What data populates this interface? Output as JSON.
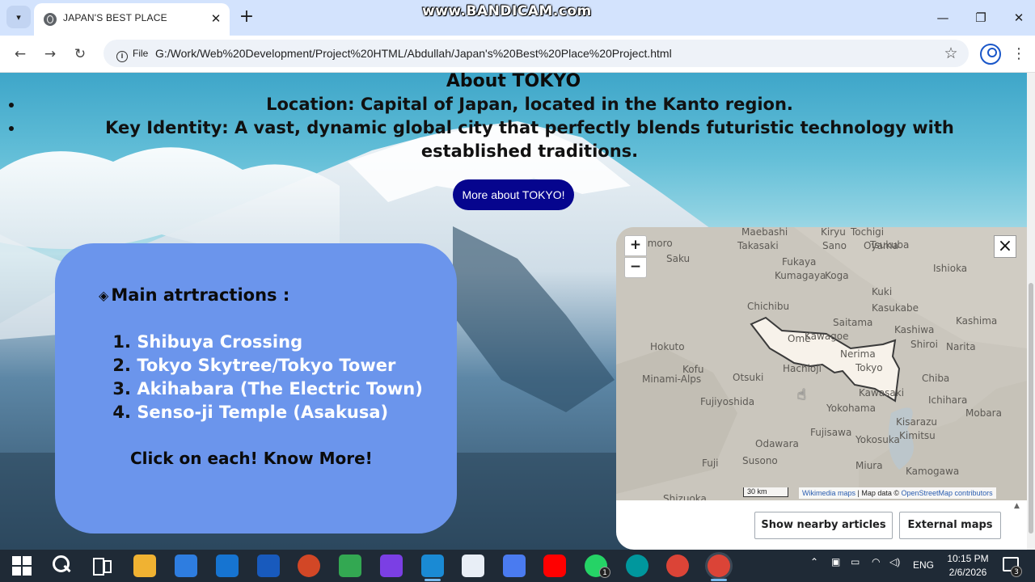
{
  "browser": {
    "tab_title": "JAPAN'S BEST PLACE",
    "file_chip": "File",
    "url": "G:/Work/Web%20Development/Project%20HTML/Abdullah/Japan's%20Best%20Place%20Project.html",
    "watermark": "www.BANDICAM.com",
    "icons": [
      "tab-search-icon",
      "globe-icon",
      "close-icon",
      "plus-icon",
      "back-icon",
      "forward-icon",
      "reload-icon",
      "info-icon",
      "star-icon",
      "profile-icon",
      "menu-icon",
      "minimize-icon",
      "restore-icon",
      "window-close-icon"
    ]
  },
  "page": {
    "heading": "About TOKYO",
    "bullets": [
      {
        "label": "Location:",
        "text": "Capital of Japan, located in the Kanto region."
      },
      {
        "label": "Key Identity:",
        "text": "A vast, dynamic global city that perfectly blends futuristic technology with established traditions."
      }
    ],
    "more_button": "More about TOKYO!",
    "accent_button_color": "#06058e",
    "card_color": "#6b95ec",
    "attractions": {
      "heading_symbol": "◈",
      "heading": "Main atrtractions :",
      "items": [
        {
          "num": "1.",
          "name": "Shibuya Crossing"
        },
        {
          "num": "2.",
          "name": "Tokyo Skytree/Tokyo Tower"
        },
        {
          "num": "3.",
          "name": "Akihabara (The Electric Town)"
        },
        {
          "num": "4.",
          "name": "Senso-ji Temple (Asakusa)"
        }
      ],
      "cta": "Click on each! Know More!"
    }
  },
  "map": {
    "zoom_in": "+",
    "zoom_out": "−",
    "close": "×",
    "scale": "30 km",
    "attribution_link1": "Wikimedia maps",
    "attribution_mid": " | Map data © ",
    "attribution_link2": "OpenStreetMap contributors",
    "places": [
      "Komoro",
      "Maebashi",
      "Takasaki",
      "Saku",
      "Kiryu",
      "Tochigi",
      "Sano",
      "Oyama",
      "Tsukuba",
      "Ishioka",
      "Fukaya",
      "Kumagaya",
      "Koga",
      "Kuki",
      "Chichibu",
      "Kasukabe",
      "Saitama",
      "Kashiwa",
      "Kashima",
      "Kawagoe",
      "Hokuto",
      "Ome",
      "Nerima",
      "Tokyo",
      "Shiroi",
      "Narita",
      "Kofu",
      "Minami-Alps",
      "Otsuki",
      "Hachioji",
      "Chiba",
      "Fujiyoshida",
      "Kawasaki",
      "Ichihara",
      "Yokohama",
      "Kisarazu",
      "Mobara",
      "Kimitsu",
      "Odawara",
      "Fujisawa",
      "Yokosuka",
      "Fuji",
      "Susono",
      "Miura",
      "Kamogawa",
      "Shizuoka"
    ],
    "buttons": [
      "Show nearby articles",
      "External maps"
    ]
  },
  "taskbar": {
    "apps": [
      "start-icon",
      "search-icon",
      "task-view-icon",
      "file-explorer-icon",
      "store-icon",
      "outlook-icon",
      "word-icon",
      "powerpoint-icon",
      "excel-like-icon",
      "visual-studio-icon",
      "vscode-icon",
      "image-app-icon",
      "copilot-icon",
      "youtube-icon",
      "whatsapp-icon",
      "arduino-icon",
      "chrome-icon",
      "chrome-active-icon"
    ],
    "whatsapp_badge": "1",
    "language": "ENG",
    "time": "10:15 PM",
    "date": "2/6/2026",
    "notification_count": "3"
  }
}
